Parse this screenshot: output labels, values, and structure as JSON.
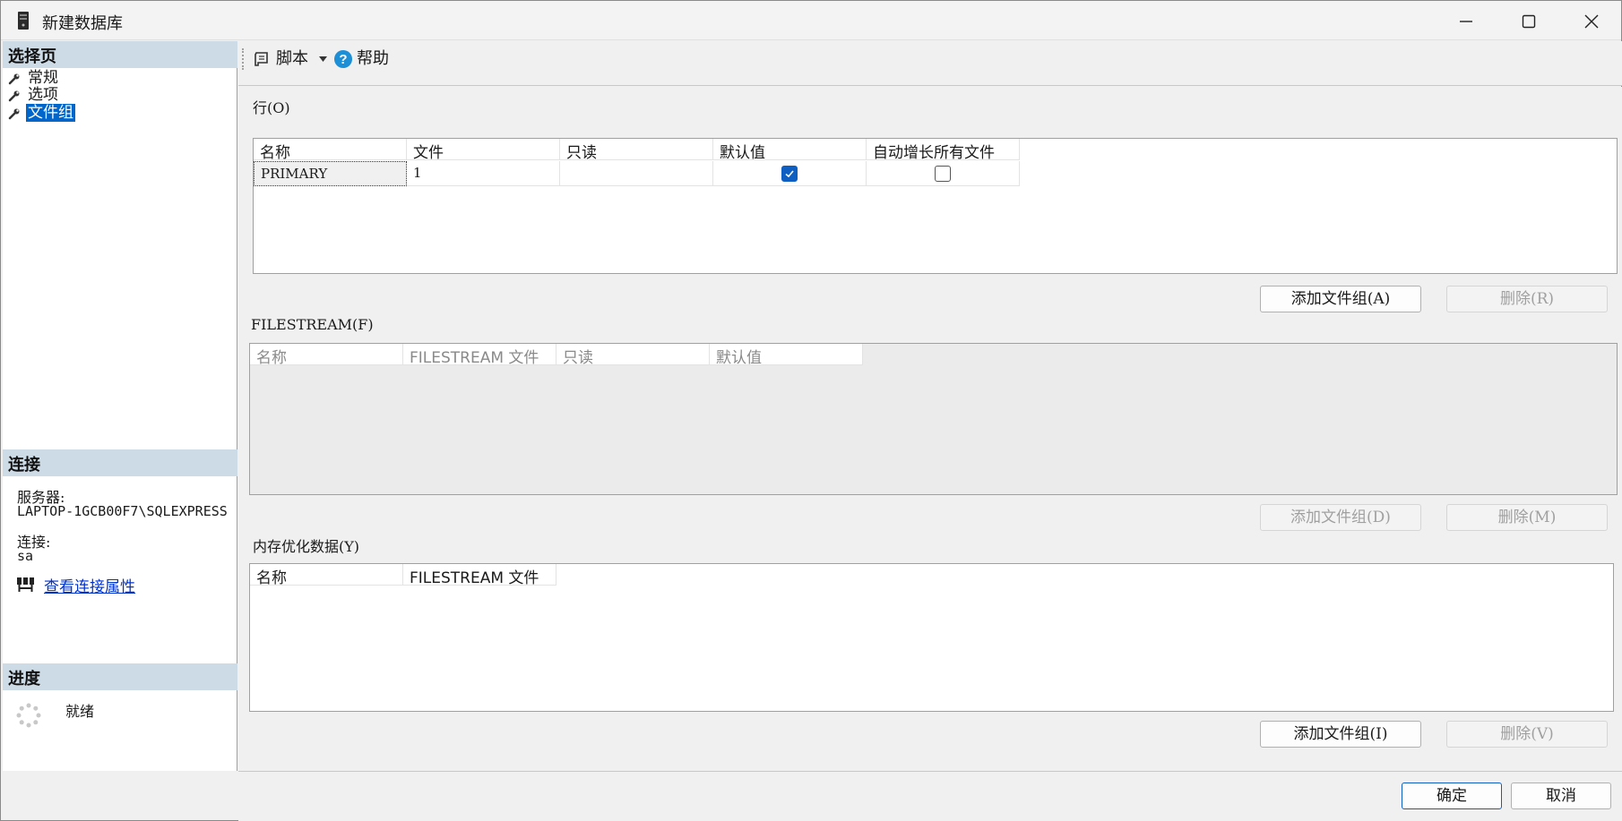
{
  "window": {
    "title": "新建数据库",
    "minimize_glyph": "—",
    "maximize_glyph": "▢",
    "close_glyph": "✕"
  },
  "left_panel": {
    "select_page_header": "选择页",
    "pages": [
      {
        "label": "常规",
        "selected": false
      },
      {
        "label": "选项",
        "selected": false
      },
      {
        "label": "文件组",
        "selected": true
      }
    ],
    "connection_header": "连接",
    "server_label": "服务器:",
    "server_value": "LAPTOP-1GCB00F7\\SQLEXPRESS",
    "connection_label": "连接:",
    "connection_value": "sa",
    "view_properties_link": "查看连接属性",
    "progress_header": "进度",
    "progress_status": "就绪"
  },
  "toolbar": {
    "script_label": "脚本",
    "help_label": "帮助"
  },
  "rows_section": {
    "label": "行(O)",
    "columns": [
      "名称",
      "文件",
      "只读",
      "默认值",
      "自动增长所有文件"
    ],
    "rows": [
      {
        "name": "PRIMARY",
        "files": "1",
        "readonly": "",
        "default": true,
        "autogrow": false
      }
    ],
    "add_button": "添加文件组(A)",
    "remove_button": "删除(R)"
  },
  "filestream_section": {
    "label": "FILESTREAM(F)",
    "columns": [
      "名称",
      "FILESTREAM 文件",
      "只读",
      "默认值"
    ],
    "add_button": "添加文件组(D)",
    "remove_button": "删除(M)"
  },
  "memory_section": {
    "label": "内存优化数据(Y)",
    "columns": [
      "名称",
      "FILESTREAM 文件"
    ],
    "add_button": "添加文件组(I)",
    "remove_button": "删除(V)"
  },
  "footer": {
    "ok_button": "确定",
    "cancel_button": "取消"
  },
  "colors": {
    "accent": "#0066cc",
    "section_header": "#cddbe7",
    "checkbox_on": "#0f5fc2",
    "link": "#0033cc"
  }
}
